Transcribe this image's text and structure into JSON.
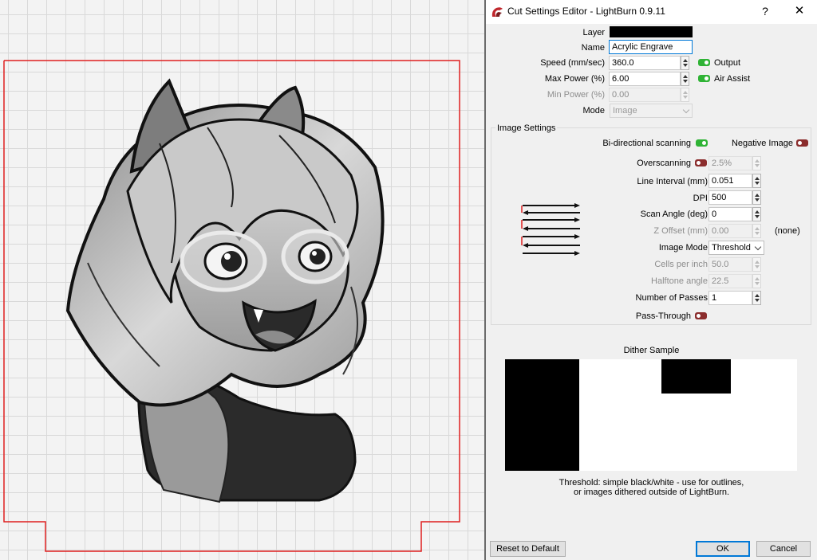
{
  "window": {
    "title": "Cut Settings Editor - LightBurn 0.9.11",
    "help": "?",
    "close": "✕"
  },
  "layer": {
    "label": "Layer",
    "color": "#000000"
  },
  "name": {
    "label": "Name",
    "value": "Acrylic Engrave"
  },
  "speed": {
    "label": "Speed (mm/sec)",
    "value": "360.0"
  },
  "max_power": {
    "label": "Max Power (%)",
    "value": "6.00"
  },
  "min_power": {
    "label": "Min Power (%)",
    "value": "0.00"
  },
  "mode": {
    "label": "Mode",
    "value": "Image"
  },
  "output": {
    "label": "Output",
    "on": true
  },
  "air_assist": {
    "label": "Air Assist",
    "on": true
  },
  "image_settings": {
    "title": "Image Settings",
    "bidirectional": {
      "label": "Bi-directional scanning",
      "on": true
    },
    "negative_image": {
      "label": "Negative Image",
      "on": false
    },
    "overscanning": {
      "label": "Overscanning",
      "on": false,
      "value": "2.5%"
    },
    "line_interval": {
      "label": "Line Interval (mm)",
      "value": "0.051"
    },
    "dpi": {
      "label": "DPI",
      "value": "500"
    },
    "scan_angle": {
      "label": "Scan Angle (deg)",
      "value": "0"
    },
    "z_offset": {
      "label": "Z Offset (mm)",
      "value": "0.00",
      "note": "(none)"
    },
    "image_mode": {
      "label": "Image Mode",
      "value": "Threshold"
    },
    "cells_per_inch": {
      "label": "Cells per inch",
      "value": "50.0"
    },
    "halftone_angle": {
      "label": "Halftone angle",
      "value": "22.5"
    },
    "passes": {
      "label": "Number of Passes",
      "value": "1"
    },
    "pass_through": {
      "label": "Pass-Through",
      "on": false
    }
  },
  "dither": {
    "title": "Dither Sample",
    "description_line1": "Threshold: simple black/white - use for outlines,",
    "description_line2": "or images dithered outside of LightBurn."
  },
  "buttons": {
    "reset": "Reset to Default",
    "ok": "OK",
    "cancel": "Cancel"
  },
  "colors": {
    "toggle_on": "#2fb335",
    "toggle_off": "#8b2d2d",
    "boundary": "#e02020",
    "accent": "#0078d7"
  }
}
